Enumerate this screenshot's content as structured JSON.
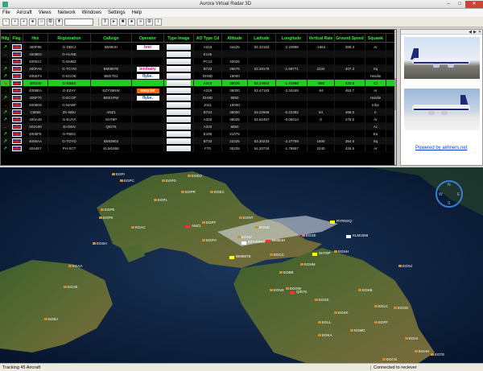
{
  "window": {
    "title": "Aurora Virtual Radar 3D",
    "min": "–",
    "max": "□",
    "close": "✕"
  },
  "menu": [
    "File",
    "Aircraft",
    "Views",
    "Network",
    "Windows",
    "Settings",
    "Help"
  ],
  "grid": {
    "columns": [
      "Hdg",
      "Flag",
      "Hex",
      "Registration",
      "Callsign",
      "Operator",
      "Type Image",
      "AO Type Cd",
      "Altitude",
      "Latitude",
      "Longitude",
      "Vertical Rate",
      "Ground Speed",
      "Squawk"
    ],
    "rows": [
      {
        "hdg": "↗",
        "hex": "400F95",
        "reg": "G-DBCJ",
        "call": "BMI84H",
        "op": "bmi",
        "icao": "A319",
        "alt": "34425",
        "lat": "54.33183",
        "lon": "-2.20898",
        "vr": "-1664",
        "gs": "389.3",
        "sq": "Ar"
      },
      {
        "hdg": "→",
        "hex": "4008E0",
        "reg": "G-HUNE",
        "call": "",
        "op": "",
        "icao": "E145",
        "alt": "",
        "lat": "",
        "lon": "",
        "vr": "",
        "gs": "",
        "sq": ""
      },
      {
        "hdg": "→",
        "hex": "40051C",
        "reg": "G-EMBZ",
        "call": "",
        "op": "",
        "icao": "PC12",
        "alt": "20025",
        "lat": "",
        "lon": "",
        "vr": "",
        "gs": "",
        "sq": ""
      },
      {
        "hdg": "↗",
        "hex": "400FA5",
        "reg": "G-TCYM",
        "call": "BMI86TE",
        "op": "bmibaby",
        "icao": "B733",
        "alt": "26675",
        "lat": "53.28179",
        "lon": "-1.69771",
        "vr": "2234",
        "gs": "407.3",
        "sq": "Sq"
      },
      {
        "hdg": "↗",
        "hex": "405EF4",
        "reg": "G-ECOE",
        "call": "BEE7D2",
        "op": "flybe.",
        "icao": "DH8D",
        "alt": "18000",
        "lat": "",
        "lon": "",
        "vr": "",
        "gs": "",
        "sq": "Hardie"
      },
      {
        "hdg": "↘",
        "hex": "400340",
        "reg": "G-EBBS",
        "call": "",
        "op": "",
        "icao": "A319",
        "alt": "38025",
        "lat": "53.24953",
        "lon": "-1.41888",
        "vr": "-960",
        "gs": "433.5",
        "sq": "Cl"
      },
      {
        "hdg": "→",
        "hex": "4008EA",
        "reg": "G-EZAY",
        "call": "EZY39NW",
        "op": "easyJet",
        "icao": "A319",
        "alt": "36000",
        "lat": "53.47183",
        "lon": "-2.34448",
        "vr": "-64",
        "gs": "463.7",
        "sq": "Ar"
      },
      {
        "hdg": "↗",
        "hex": "405F70",
        "reg": "G-ECOF",
        "call": "BEE1RW",
        "op": "flybe.",
        "icao": "DH8D",
        "alt": "9850",
        "lat": "",
        "lon": "",
        "vr": "",
        "gs": "",
        "sq": "Hardie"
      },
      {
        "hdg": "→",
        "hex": "4008D6",
        "reg": "G-MABF",
        "call": "",
        "op": "",
        "icao": "J041",
        "alt": "19000",
        "lat": "",
        "lon": "",
        "vr": "",
        "gs": "",
        "sq": "Infor"
      },
      {
        "hdg": "↗",
        "hex": "C8855",
        "reg": "ZK-NBU",
        "call": "ANZ1",
        "op": "",
        "icao": "B744",
        "alt": "38000",
        "lat": "53.22669",
        "lon": "-0.22382",
        "vr": "64",
        "gs": "468.0",
        "sq": "Ir"
      },
      {
        "hdg": "↗",
        "hex": "400A49",
        "reg": "G-EUYA",
        "call": "SHT8P",
        "op": "",
        "icao": "A320",
        "alt": "38025",
        "lat": "53.62467",
        "lon": "-0.06014",
        "vr": "0",
        "gs": "475.0",
        "sq": "Ar"
      },
      {
        "hdg": "→",
        "hex": "4D2190",
        "reg": "EI-DEN",
        "call": "QID76",
        "op": "",
        "icao": "A320",
        "alt": "8850",
        "lat": "",
        "lon": "",
        "vr": "",
        "gs": "",
        "sq": "Ac"
      },
      {
        "hdg": "↗",
        "hex": "4006FE",
        "reg": "G-FBEC",
        "call": "",
        "op": "",
        "icao": "E195",
        "alt": "21075",
        "lat": "",
        "lon": "",
        "vr": "",
        "gs": "",
        "sq": "Ea"
      },
      {
        "hdg": "↗",
        "hex": "4006AA",
        "reg": "G-TOYD",
        "call": "BMI3903",
        "op": "",
        "icao": "B733",
        "alt": "22225",
        "lat": "53.30233",
        "lon": "-2.27759",
        "vr": "1600",
        "gs": "354.0",
        "sq": "Sq"
      },
      {
        "hdg": "↗",
        "hex": "4044E7",
        "reg": "PH-XCT",
        "call": "KLM1558",
        "op": "",
        "icao": "F70",
        "alt": "30225",
        "lat": "54.20734",
        "lon": "-1.78857",
        "vr": "2240",
        "gs": "426.5",
        "sq": "Ar"
      }
    ]
  },
  "side": {
    "link": "Powered by airliners.net",
    "tabs": [
      "◀",
      "▶",
      "✕"
    ]
  },
  "map": {
    "airports": [
      {
        "code": "EGPI"
      },
      {
        "code": "EGPC"
      },
      {
        "code": "EGEO"
      },
      {
        "code": "EGPD"
      },
      {
        "code": "EGPR"
      },
      {
        "code": "EGEC"
      },
      {
        "code": "EGPL"
      },
      {
        "code": "EGPE"
      },
      {
        "code": "EGPK"
      },
      {
        "code": "EGPF"
      },
      {
        "code": "EGNT"
      },
      {
        "code": "EGNV"
      },
      {
        "code": "EGPH"
      },
      {
        "code": "EGNS"
      },
      {
        "code": "EGCC"
      },
      {
        "code": "EGBB"
      },
      {
        "code": "EGNX"
      },
      {
        "code": "EGGW"
      },
      {
        "code": "EGSS"
      },
      {
        "code": "EGLL"
      },
      {
        "code": "EGKK"
      },
      {
        "code": "EGAA"
      },
      {
        "code": "EGAC"
      },
      {
        "code": "EGAE"
      },
      {
        "code": "EGNM"
      },
      {
        "code": "EGNH"
      },
      {
        "code": "EGFF"
      },
      {
        "code": "EGGD"
      },
      {
        "code": "EGHI"
      },
      {
        "code": "EGHH"
      },
      {
        "code": "EGTE"
      },
      {
        "code": "EGKB"
      },
      {
        "code": "EGLC"
      },
      {
        "code": "EGMD"
      },
      {
        "code": "EGKA"
      },
      {
        "code": "EGBJ"
      },
      {
        "code": "EGSH"
      },
      {
        "code": "EGNJ"
      },
      {
        "code": "EGXE"
      },
      {
        "code": "EGCN"
      }
    ],
    "aircraft": [
      {
        "label": "ANZ1"
      },
      {
        "label": "BMI86TE"
      },
      {
        "label": "EZY39NW"
      },
      {
        "label": "SHT8P"
      },
      {
        "label": "KLM1558"
      },
      {
        "label": "BMI84H"
      },
      {
        "label": "QID76"
      },
      {
        "label": "RYR5GQ"
      }
    ],
    "compass": {
      "n": "N",
      "e": "E",
      "s": "S",
      "w": "W"
    }
  },
  "status": {
    "left": "Tracking 45 Aircraft",
    "right": "Connected to reciever"
  }
}
